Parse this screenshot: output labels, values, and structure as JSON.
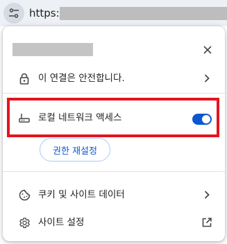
{
  "address_bar": {
    "url_prefix": "https://"
  },
  "popup": {
    "connection": {
      "label": "이 연결은 안전합니다."
    },
    "local_network": {
      "label": "로컬 네트워크 액세스",
      "enabled": true
    },
    "reset_permissions": {
      "label": "권한 재설정"
    },
    "cookies": {
      "label": "쿠키 및 사이트 데이터"
    },
    "site_settings": {
      "label": "사이트 설정"
    }
  },
  "colors": {
    "accent": "#0b57d0",
    "highlight": "#e3141e",
    "text": "#1f1f1f",
    "icon": "#444746"
  },
  "icons": {
    "site_info": "tune-icon",
    "close": "close-icon",
    "lock": "lock-icon",
    "router": "router-icon",
    "cookie": "cookie-icon",
    "gear": "gear-icon",
    "chevron": "chevron-right-icon",
    "external": "open-in-new-icon"
  }
}
